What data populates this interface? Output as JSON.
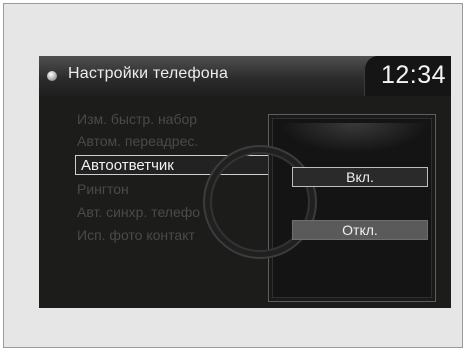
{
  "header": {
    "title": "Настройки телефона",
    "clock": "12:34"
  },
  "menu": {
    "items": [
      {
        "label": "Изм. быстр. набор",
        "state": "dim"
      },
      {
        "label": "Автом. переадрес.",
        "state": "dim"
      },
      {
        "label": "Автоответчик",
        "state": "active"
      },
      {
        "label": "Рингтон",
        "state": "dim"
      },
      {
        "label": "Авт. синхр. телефо",
        "state": "dim"
      },
      {
        "label": "Исп. фото контакт",
        "state": "dim"
      }
    ]
  },
  "popup": {
    "options": [
      {
        "label": "Вкл.",
        "selected": true
      },
      {
        "label": "Откл.",
        "selected": false
      }
    ]
  },
  "colors": {
    "screen_bg": "#1c1c1b",
    "highlight_border": "#cfcfcf",
    "dim_text": "#4a4a4a"
  }
}
